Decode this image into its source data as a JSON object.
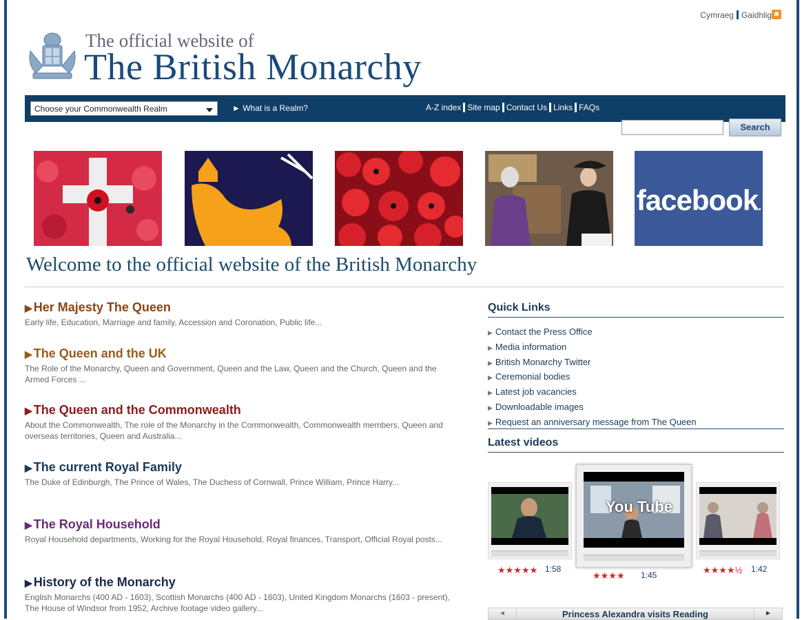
{
  "header": {
    "lang_links": [
      "Cymraeg",
      "Gaidhlig"
    ],
    "rss_icon": "rss-icon",
    "logo_small": "The official website of",
    "logo_big": "The British Monarchy",
    "crest_icon": "royal-coat-of-arms"
  },
  "nav": {
    "realm_select": "Choose your Commonwealth Realm",
    "what_realm": "► What is a Realm?",
    "links": [
      "A-Z index",
      "Site map",
      "Contact Us",
      "Links",
      "FAQs"
    ],
    "search_button": "Search",
    "search_value": ""
  },
  "banners": {
    "facebook_text": "facebook",
    "b5_dot": "."
  },
  "welcome": "Welcome to the official website of the British Monarchy",
  "sections": [
    {
      "title": "Her Majesty The Queen",
      "desc": "Early life, Education, Marriage and family, Accession and Coronation, Public life...",
      "color": "#8b4513"
    },
    {
      "title": "The Queen and the UK",
      "desc": "The Role of the Monarchy, Queen and Government, Queen and the Law, Queen and the Church, Queen and the Armed Forces ...",
      "color": "#9c5a1a"
    },
    {
      "title": "The Queen and the Commonwealth",
      "desc": "About the Commonwealth, The role of the Monarchy in the Commonwealth, Commonwealth members, Queen and overseas territories, Queen and Australia...",
      "color": "#8a1c1c"
    },
    {
      "title": "The current Royal Family",
      "desc": "The Duke of Edinburgh, The Prince of Wales, The Duchess of Cornwall, Prince William, Prince Harry...",
      "color": "#1a3a5a"
    },
    {
      "title": "The Royal Household",
      "desc": "Royal Household departments, Working for the Royal Household, Royal finances, Transport, Official Royal posts...",
      "color": "#6a2a7a"
    },
    {
      "title": "History of the Monarchy",
      "desc": "English Monarchs (400 AD - 1603), Scottish Monarchs (400 AD - 1603), United Kingdom Monarchs (1603 - present), The House of Windsor from 1952, Archive footage video gallery...",
      "color": "#1a2a4a"
    }
  ],
  "quick_links": {
    "heading": "Quick Links",
    "items": [
      "Contact the Press Office",
      "Media information",
      "British Monarchy Twitter",
      "Ceremonial bodies",
      "Latest job vacancies",
      "Downloadable images",
      "Request an anniversary message from The Queen"
    ]
  },
  "latest_videos": {
    "heading": "Latest videos",
    "videos": [
      {
        "stars": "★★★★★",
        "duration": "1:58"
      },
      {
        "stars": "★★★★",
        "duration": "1:45",
        "logo": "You Tube"
      },
      {
        "stars": "★★★★½",
        "duration": "1:42"
      }
    ],
    "carousel_title": "Princess Alexandra visits Reading",
    "prev": "◄",
    "next": "►"
  }
}
